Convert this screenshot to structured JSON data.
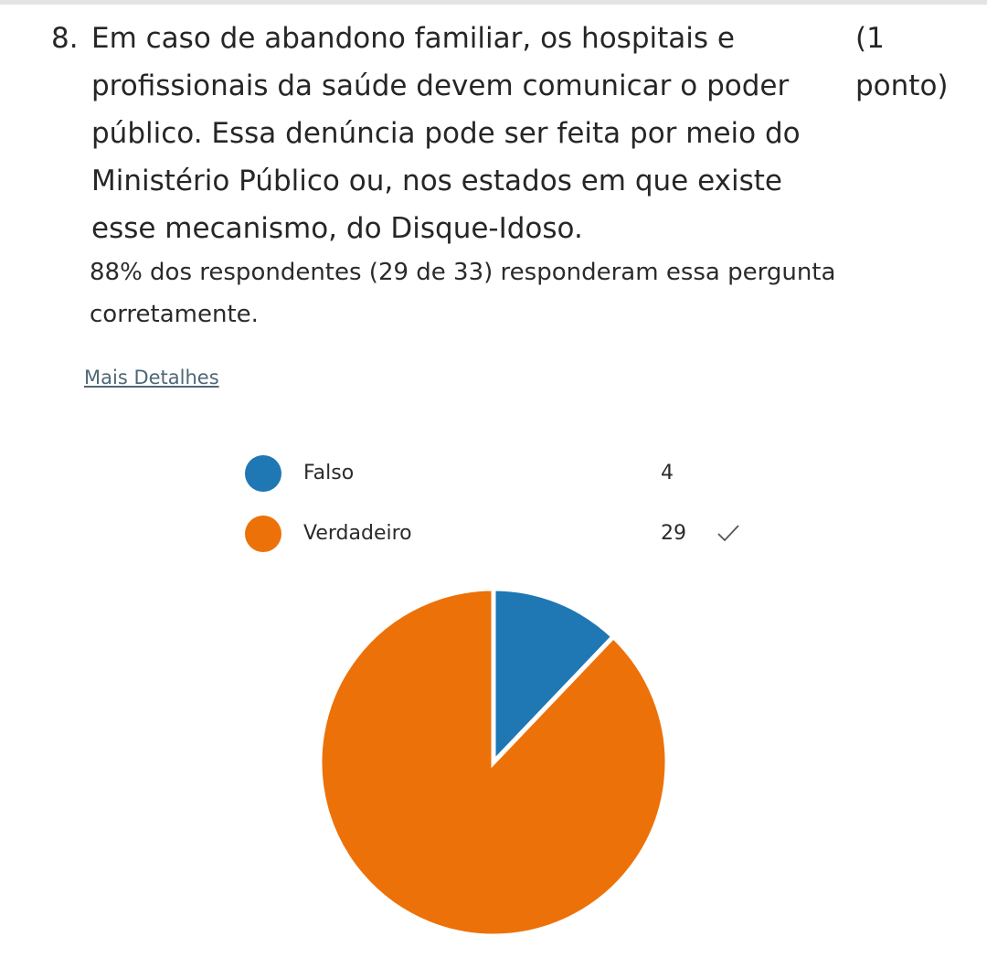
{
  "question": {
    "number": "8.",
    "text": "Em caso de abandono familiar, os hospitais e profissionais da saúde devem comunicar o poder público. Essa denúncia pode ser feita por meio do Ministério Público ou, nos estados em que existe esse mecanismo, do Disque-Idoso.",
    "points": "(1 ponto)"
  },
  "summary": "88% dos respondentes (29 de 33) responderam essa pergunta corretamente.",
  "details_link": "Mais Detalhes",
  "legend": [
    {
      "label": "Falso",
      "count": "4",
      "color": "#1f77b4",
      "correct": false
    },
    {
      "label": "Verdadeiro",
      "count": "29",
      "color": "#ed7109",
      "correct": true
    }
  ],
  "chart_data": {
    "type": "pie",
    "categories": [
      "Falso",
      "Verdadeiro"
    ],
    "values": [
      4,
      29
    ],
    "colors": [
      "#1f77b4",
      "#ed7109"
    ],
    "start": "top",
    "direction": "clockwise",
    "legend": "top"
  },
  "icons": {
    "correct_marker": "check-icon"
  }
}
